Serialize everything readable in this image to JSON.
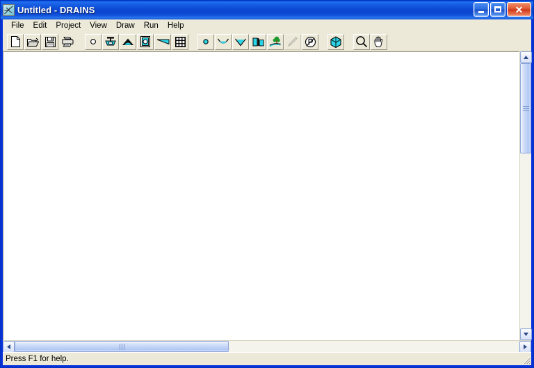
{
  "window": {
    "title": "Untitled - DRAINS",
    "app_icon": "drainage-network-icon",
    "frame_color": "#0831d9",
    "titlebar_color": "#0b47d2",
    "face_color": "#ece9d8"
  },
  "title_buttons": {
    "minimize_label": "Minimize",
    "maximize_label": "Maximize",
    "close_label": "Close",
    "close_color": "#d0381a"
  },
  "menubar": {
    "items": [
      {
        "label": "File"
      },
      {
        "label": "Edit"
      },
      {
        "label": "Project"
      },
      {
        "label": "View"
      },
      {
        "label": "Draw"
      },
      {
        "label": "Run"
      },
      {
        "label": "Help"
      }
    ]
  },
  "toolbar": {
    "groups": [
      {
        "name": "file-group",
        "buttons": [
          {
            "icon": "new-file-icon",
            "tooltip": "New",
            "framed": true,
            "disabled": false
          },
          {
            "icon": "open-folder-icon",
            "tooltip": "Open",
            "framed": true,
            "disabled": false
          },
          {
            "icon": "save-floppy-icon",
            "tooltip": "Save",
            "framed": true,
            "disabled": false
          },
          {
            "icon": "print-icon",
            "tooltip": "Print",
            "framed": false,
            "disabled": false
          }
        ]
      },
      {
        "name": "drainage-elements-group",
        "buttons": [
          {
            "icon": "node-circle-icon",
            "tooltip": "Node",
            "framed": true,
            "disabled": false
          },
          {
            "icon": "pit-inlet-icon",
            "tooltip": "Pit",
            "framed": true,
            "disabled": false
          },
          {
            "icon": "overflow-arch-icon",
            "tooltip": "Overflow Route",
            "framed": true,
            "disabled": false
          },
          {
            "icon": "detention-basin-icon",
            "tooltip": "Detention Basin",
            "framed": true,
            "disabled": false
          },
          {
            "icon": "channel-wedge-icon",
            "tooltip": "Channel",
            "framed": true,
            "disabled": false
          },
          {
            "icon": "grid-table-icon",
            "tooltip": "Table",
            "framed": true,
            "disabled": false
          }
        ]
      },
      {
        "name": "hydraulic-elements-group",
        "buttons": [
          {
            "icon": "cyan-node-icon",
            "tooltip": "Node",
            "framed": true,
            "disabled": false
          },
          {
            "icon": "u-channel-icon",
            "tooltip": "U Channel",
            "framed": true,
            "disabled": false
          },
          {
            "icon": "v-channel-icon",
            "tooltip": "V Channel",
            "framed": true,
            "disabled": false
          },
          {
            "icon": "culvert-icon",
            "tooltip": "Culvert",
            "framed": true,
            "disabled": false
          },
          {
            "icon": "subcatchment-tree-icon",
            "tooltip": "Sub-catchment",
            "framed": true,
            "disabled": false
          },
          {
            "icon": "pencil-icon",
            "tooltip": "Draw",
            "framed": true,
            "disabled": true
          },
          {
            "icon": "circled-p-icon",
            "tooltip": "Properties",
            "framed": true,
            "disabled": false
          }
        ]
      },
      {
        "name": "model-group",
        "buttons": [
          {
            "icon": "cube-3d-icon",
            "tooltip": "Model",
            "framed": true,
            "disabled": false
          }
        ]
      },
      {
        "name": "view-tools-group",
        "buttons": [
          {
            "icon": "magnifier-zoom-icon",
            "tooltip": "Zoom",
            "framed": true,
            "disabled": false
          },
          {
            "icon": "pan-hand-icon",
            "tooltip": "Pan",
            "framed": true,
            "disabled": false
          }
        ]
      }
    ]
  },
  "canvas": {
    "background": "#ffffff",
    "content": ""
  },
  "scrollbars": {
    "vertical": {
      "up_arrow": "scroll-up-arrow",
      "down_arrow": "scroll-down-arrow"
    },
    "horizontal": {
      "left_arrow": "scroll-left-arrow",
      "right_arrow": "scroll-right-arrow"
    }
  },
  "statusbar": {
    "message": "Press F1 for help."
  }
}
